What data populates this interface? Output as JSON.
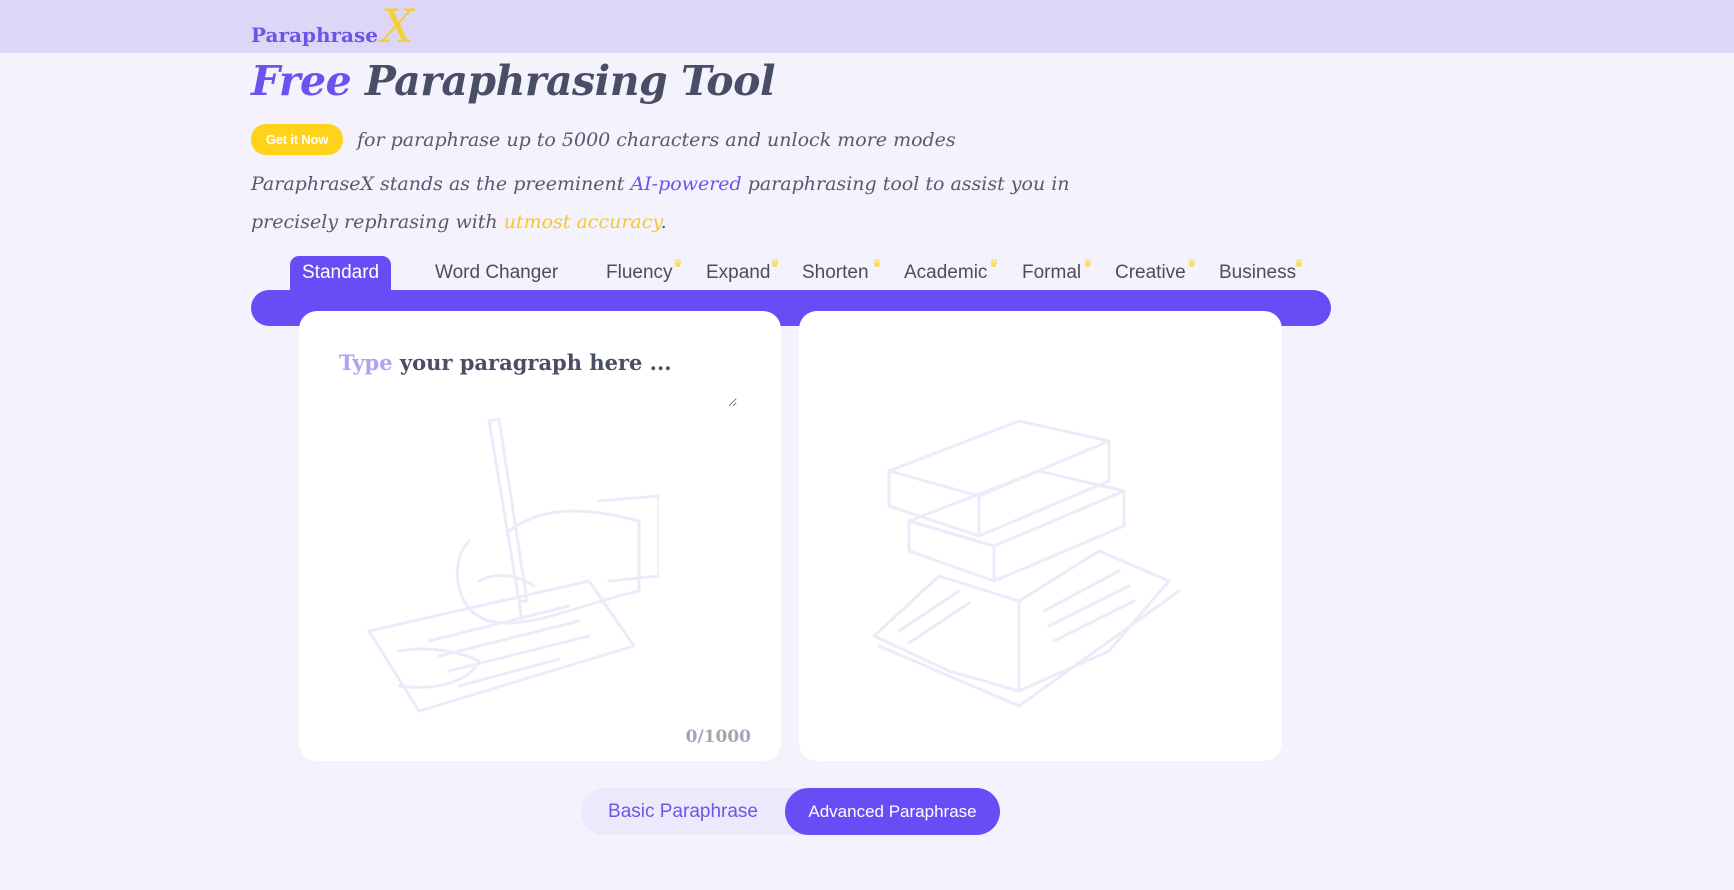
{
  "header": {
    "logo_text": "Paraphrase",
    "logo_mark": "X"
  },
  "hero": {
    "title_accent": "Free",
    "title_rest": "Paraphrasing Tool",
    "get_it_now": "Get it Now",
    "promo_text": "for paraphrase up to 5000 characters and unlock more modes",
    "desc_part1": "ParaphraseX stands as the preeminent ",
    "desc_highlight1": "AI-powered",
    "desc_part2": " paraphrasing tool to assist you in precisely rephrasing with ",
    "desc_highlight2": "utmost accuracy",
    "desc_part3": "."
  },
  "tabs": [
    {
      "label": "Standard",
      "premium": false,
      "active": true
    },
    {
      "label": "Word Changer",
      "premium": false,
      "active": false
    },
    {
      "label": "Fluency",
      "premium": true,
      "active": false
    },
    {
      "label": "Expand",
      "premium": true,
      "active": false
    },
    {
      "label": "Shorten",
      "premium": true,
      "active": false
    },
    {
      "label": "Academic",
      "premium": true,
      "active": false
    },
    {
      "label": "Formal",
      "premium": true,
      "active": false
    },
    {
      "label": "Creative",
      "premium": true,
      "active": false
    },
    {
      "label": "Business",
      "premium": true,
      "active": false
    }
  ],
  "editor": {
    "placeholder_accent": "Type",
    "placeholder_rest": " your paragraph here ...",
    "counter": "0/1000",
    "input_illustration": "hand-writing-illustration",
    "output_illustration": "books-illustration"
  },
  "modes": {
    "basic_label": "Basic Paraphrase",
    "advanced_label": "Advanced Paraphrase",
    "selected": "Advanced Paraphrase"
  },
  "colors": {
    "brand": "#6a4cf7",
    "accent_yellow": "#ffd21c",
    "topbar": "#ddd6f7",
    "background": "#f4f3fd"
  }
}
